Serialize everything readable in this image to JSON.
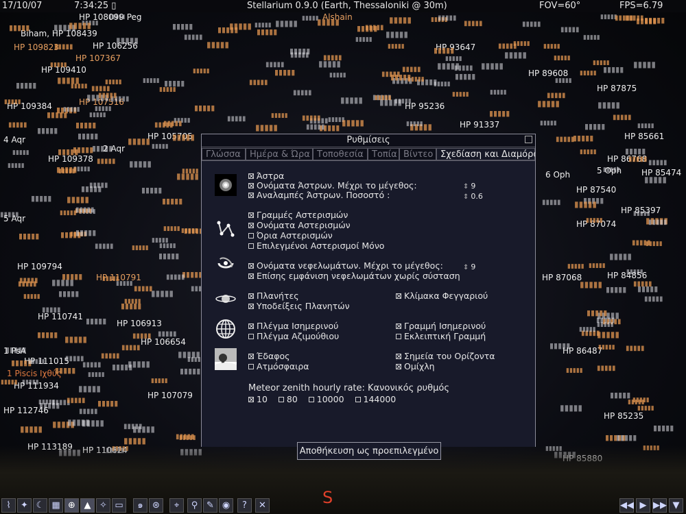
{
  "topbar": {
    "date": "17/10/07",
    "time": "7:34:25 ▯",
    "title": "Stellarium 0.9.0 (Earth, Thessaloniki @ 30m)",
    "fov": "FOV=60°",
    "fps": "FPS=6.79"
  },
  "sky_labels": [
    {
      "t": "HP 108099 Peg",
      "c": "#f0f0f0"
    },
    {
      "t": "HP 109823",
      "c": "#e8a060"
    },
    {
      "t": "HP 106256",
      "c": "#f0f0f0"
    },
    {
      "t": "Biham, HP 108439",
      "c": "#f0f0f0"
    },
    {
      "t": "HP 107367",
      "c": "#e8a060"
    },
    {
      "t": "HP 109410",
      "c": "#f0f0f0"
    },
    {
      "t": "HP 109384",
      "c": "#f0f0f0"
    },
    {
      "t": "HP 107516",
      "c": "#e8a060"
    },
    {
      "t": "HP 105705",
      "c": "#f0f0f0"
    },
    {
      "t": "4 Aqr",
      "c": "#f0f0f0"
    },
    {
      "t": "2 Aqr",
      "c": "#f0f0f0"
    },
    {
      "t": "HP 109378",
      "c": "#f0f0f0"
    },
    {
      "t": "5 Aqr",
      "c": "#f0f0f0"
    },
    {
      "t": "HP 109794",
      "c": "#f0f0f0"
    },
    {
      "t": "HP 110791",
      "c": "#e8a060"
    },
    {
      "t": "HP 110741",
      "c": "#f0f0f0"
    },
    {
      "t": "HP 106913",
      "c": "#f0f0f0"
    },
    {
      "t": "HP 106654",
      "c": "#f0f0f0"
    },
    {
      "t": "1 PsA",
      "c": "#f0f0f0"
    },
    {
      "t": "HP 111015",
      "c": "#f0f0f0"
    },
    {
      "t": "1 Piscis Ιχθύς",
      "c": "#e07a40"
    },
    {
      "t": "HP 111934",
      "c": "#f0f0f0"
    },
    {
      "t": "HP 112746",
      "c": "#f0f0f0"
    },
    {
      "t": "HP 107079",
      "c": "#f0f0f0"
    },
    {
      "t": "HP 113189",
      "c": "#f0f0f0"
    },
    {
      "t": "HP 110624",
      "c": "#f0f0f0"
    },
    {
      "t": "Alshain",
      "c": "#e8a060"
    },
    {
      "t": "HP 93647",
      "c": "#f0f0f0"
    },
    {
      "t": "HP 95236",
      "c": "#f0f0f0"
    },
    {
      "t": "HP 91337",
      "c": "#f0f0f0"
    },
    {
      "t": "HP 87875",
      "c": "#f0f0f0"
    },
    {
      "t": "HP 85661",
      "c": "#f0f0f0"
    },
    {
      "t": "5 Oph",
      "c": "#f0f0f0"
    },
    {
      "t": "6 Oph",
      "c": "#f0f0f0"
    },
    {
      "t": "HP 87540",
      "c": "#f0f0f0"
    },
    {
      "t": "HP 85397",
      "c": "#f0f0f0"
    },
    {
      "t": "HP 87074",
      "c": "#f0f0f0"
    },
    {
      "t": "HP 84856",
      "c": "#f0f0f0"
    },
    {
      "t": "HP 87068",
      "c": "#f0f0f0"
    },
    {
      "t": "HP 86487",
      "c": "#f0f0f0"
    },
    {
      "t": "HP 85235",
      "c": "#f0f0f0"
    },
    {
      "t": "HP 85880",
      "c": "#f0f0f0"
    },
    {
      "t": "HP 89608",
      "c": "#f0f0f0"
    },
    {
      "t": "HP 86768",
      "c": "#f0f0f0"
    },
    {
      "t": "HP 85474",
      "c": "#f0f0f0"
    }
  ],
  "ground": {
    "cardinal": "S"
  },
  "dialog": {
    "title": "Ρυθμίσεις",
    "tabs": [
      "Γλώσσα",
      "Ημέρα & Ώρα",
      "Τοποθεσία",
      "Τοπία",
      "Βίντεο",
      "Σχεδίαση και Διαμόρφωση"
    ],
    "stars": {
      "show_stars": "Άστρα",
      "star_names": "Ονόματα Άστρων. Μέχρι το μέγεθος:",
      "star_names_value": "9",
      "twinkle": "Αναλαμπές Άστρων. Ποσοστό :",
      "twinkle_value": "0.6"
    },
    "constellations": {
      "lines": "Γραμμές Αστερισμών",
      "names": "Ονόματα Αστερισμών",
      "boundaries": "Όρια Αστερισμών",
      "selected_only": "Επιλεγμένοι Αστερισμοί Μόνο"
    },
    "nebulae": {
      "names": "Ονόματα νεφελωμάτων. Μέχρι το μέγεθος:",
      "names_value": "9",
      "no_texture": "Επίσης εμφάνιση νεφελωμάτων χωρίς σύσταση"
    },
    "planets": {
      "planets": "Πλανήτες",
      "hints": "Υποδείξεις Πλανητών",
      "moon_scale": "Κλίμακα Φεγγαριού"
    },
    "grids": {
      "equatorial_grid": "Πλέγμα Ισημερινού",
      "azimuthal_grid": "Πλέγμα Αζιμούθιου",
      "equator_line": "Γραμμή Ισημερινού",
      "ecliptic_line": "Εκλειπτική Γραμμή"
    },
    "landscape": {
      "ground": "Έδαφος",
      "atmosphere": "Ατμόσφαιρα",
      "cardinal_points": "Σημεία του Ορίζοντα",
      "fog": "Ομίχλη"
    },
    "meteor": {
      "label": "Meteor zenith hourly rate: Κανονικός ρυθμός",
      "options": [
        "10",
        "80",
        "10000",
        "144000"
      ]
    },
    "save_button": "Αποθήκευση ως προεπιλεγμένο"
  }
}
